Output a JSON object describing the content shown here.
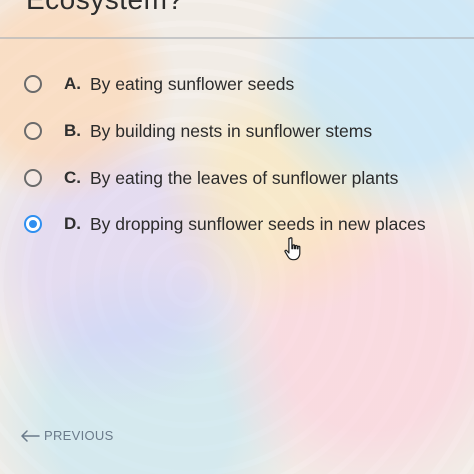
{
  "header": {
    "fragment_text": "Ecosystem?"
  },
  "question": {
    "options": [
      {
        "letter": "A.",
        "text": "By eating sunflower seeds",
        "selected": false
      },
      {
        "letter": "B.",
        "text": "By building nests in sunflower stems",
        "selected": false
      },
      {
        "letter": "C.",
        "text": "By eating the leaves of sunflower plants",
        "selected": false
      },
      {
        "letter": "D.",
        "text": "By dropping sunflower seeds in new places",
        "selected": true
      }
    ]
  },
  "navigation": {
    "previous_label": "PREVIOUS"
  },
  "icons": {
    "cursor": "hand-pointer-icon",
    "previous": "arrow-left-icon"
  },
  "colors": {
    "selected_radio": "#2f8ff0",
    "unselected_radio": "#6b6b6b",
    "previous_link": "#6a7a8a"
  }
}
